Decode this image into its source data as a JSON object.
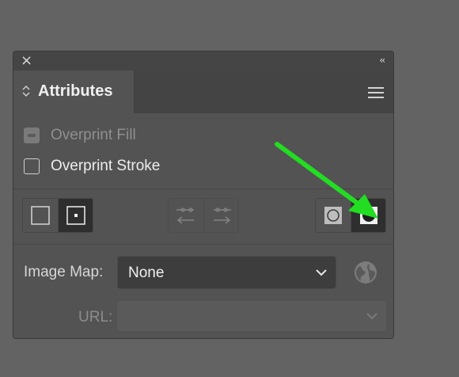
{
  "panel": {
    "tab_title": "Attributes",
    "close_icon": "close-icon",
    "collapse_glyph": "‹‹",
    "menu_icon": "hamburger-menu-icon"
  },
  "checkboxes": {
    "overprint_fill": {
      "label": "Overprint Fill",
      "state": "disabled-mixed"
    },
    "overprint_stroke": {
      "label": "Overprint Stroke",
      "checked": false
    }
  },
  "center_point": {
    "hide_icon": "hide-center-icon",
    "show_icon": "show-center-icon",
    "selected": "show"
  },
  "direction": {
    "reverse_icon": "reverse-path-left-icon",
    "forward_icon": "reverse-path-right-icon",
    "enabled": false
  },
  "fill_rule": {
    "nonzero_icon": "nonzero-winding-icon",
    "evenodd_icon": "evenodd-fill-icon",
    "selected": "evenodd"
  },
  "image_map": {
    "label": "Image Map:",
    "value": "None",
    "browser_icon": "globe-icon"
  },
  "url": {
    "label": "URL:",
    "value": "",
    "enabled": false
  },
  "annotation": {
    "color": "#22dd22",
    "target": "evenodd-fill-button"
  }
}
